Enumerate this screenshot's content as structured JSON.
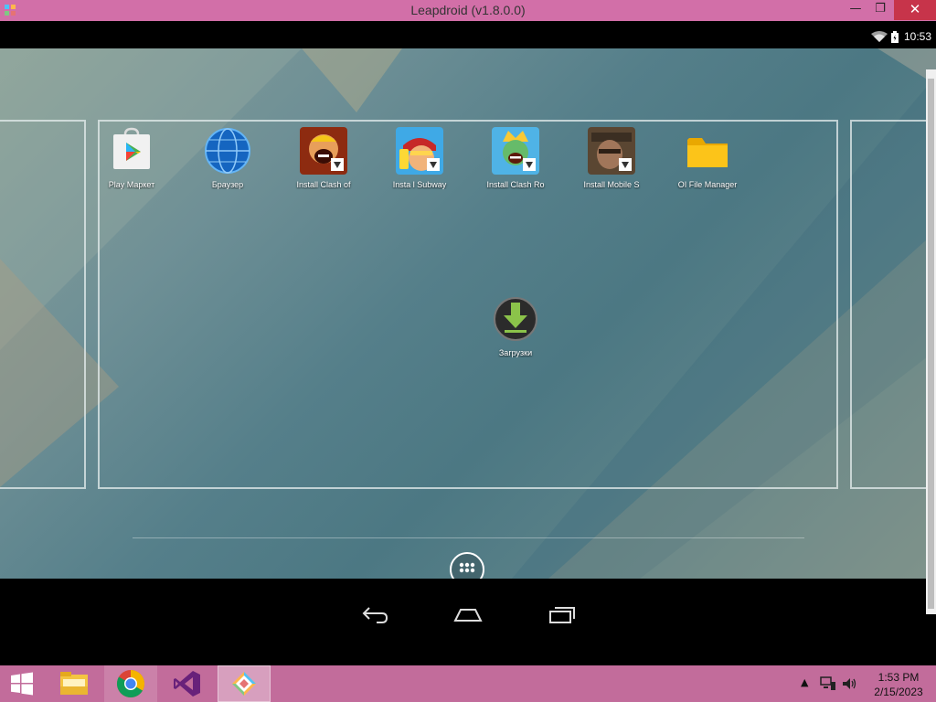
{
  "window": {
    "title": "Leapdroid (v1.8.0.0)",
    "minimize_glyph": "—",
    "maximize_glyph": "❐",
    "close_glyph": "✕"
  },
  "statusbar": {
    "time": "10:53",
    "icons": [
      "wifi-icon",
      "battery-icon"
    ]
  },
  "homescreen": {
    "apps": [
      {
        "label": "Play Маркет",
        "icon": "play-store-icon"
      },
      {
        "label": "Браузер",
        "icon": "browser-globe-icon"
      },
      {
        "label": "Install Clash of",
        "icon": "clash-of-clans-icon"
      },
      {
        "label": "Insta l Subway ",
        "icon": "subway-surfers-icon"
      },
      {
        "label": "Install Clash Ro",
        "icon": "clash-royale-icon"
      },
      {
        "label": "Install Mobile S",
        "icon": "mobile-strike-icon"
      },
      {
        "label": "OI File Manager",
        "icon": "folder-icon"
      }
    ],
    "center_app": {
      "label": "Загрузки",
      "icon": "downloads-icon"
    }
  },
  "navbar": {
    "buttons": [
      "back-icon",
      "home-icon",
      "recents-icon"
    ]
  },
  "taskbar": {
    "items": [
      "windows-start-icon",
      "file-explorer-icon",
      "chrome-icon",
      "visual-studio-icon",
      "leapdroid-icon"
    ],
    "time": "1:53 PM",
    "date": "2/15/2023",
    "tray_chevron": "▲"
  },
  "colors": {
    "titlebar": "#d26fa8",
    "taskbar": "#c26c9b",
    "close_button": "#c7344a"
  }
}
